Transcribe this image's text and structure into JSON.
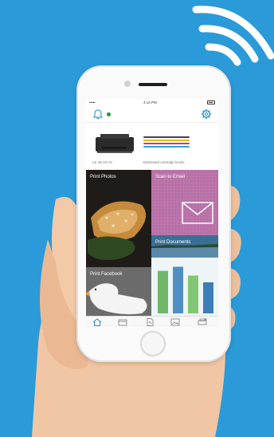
{
  "phone": {
    "status": {
      "carrier": "•••••",
      "time": "4:14 PM"
    },
    "printer": {
      "name": "LE 36-23 A3",
      "ink_label": "Estimated cartridge levels",
      "ink_colors": [
        "#444444",
        "#e6b800",
        "#c23a8b",
        "#2ba4d8"
      ]
    },
    "tiles": {
      "photos": "Print Photos",
      "scan": "Scan to Email",
      "docs": "Print Documents",
      "facebook": "Print Facebook"
    },
    "chart_bar_values": [
      0.82,
      0.9,
      0.73,
      0.6
    ],
    "colors": {
      "background": "#2a9ad8",
      "scan_tile": "#b770a6",
      "status_dot": "#1e9b3f"
    }
  }
}
